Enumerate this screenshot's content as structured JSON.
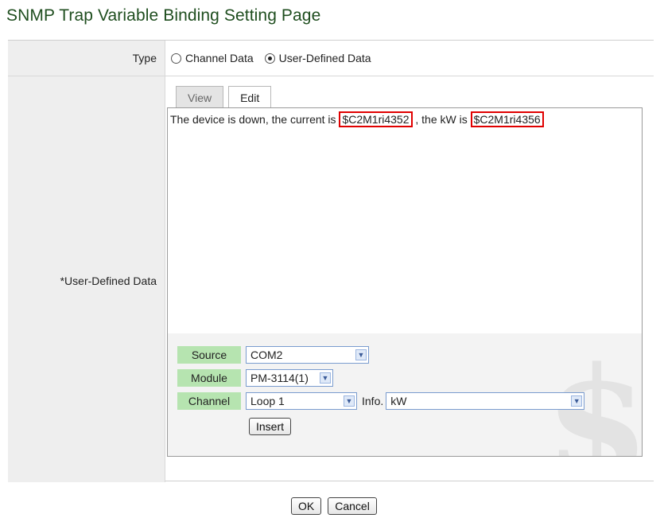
{
  "page_title": "SNMP Trap Variable Binding Setting Page",
  "type_row": {
    "label": "Type",
    "options": [
      "Channel Data",
      "User-Defined Data"
    ],
    "selected": "User-Defined Data"
  },
  "user_row": {
    "label": "*User-Defined Data",
    "tabs": [
      "View",
      "Edit"
    ],
    "active_tab": "Edit",
    "editor": {
      "text1": "The device is down, the current is ",
      "var1": "$C2M1ri4352",
      "text2": " , the kW is ",
      "var2": "$C2M1ri4356"
    },
    "source": {
      "label": "Source",
      "value": "COM2"
    },
    "module": {
      "label": "Module",
      "value": "PM-3114(1)"
    },
    "channel": {
      "label": "Channel",
      "value": "Loop 1"
    },
    "info": {
      "label": "Info.",
      "value": "kW"
    },
    "insert_label": "Insert",
    "watermark": "$"
  },
  "footer": {
    "ok_label": "OK",
    "cancel_label": "Cancel"
  },
  "icons": {
    "radio_off": "radio-unchecked-icon",
    "radio_on": "radio-checked-icon",
    "dropdown": "chevron-down-icon"
  }
}
